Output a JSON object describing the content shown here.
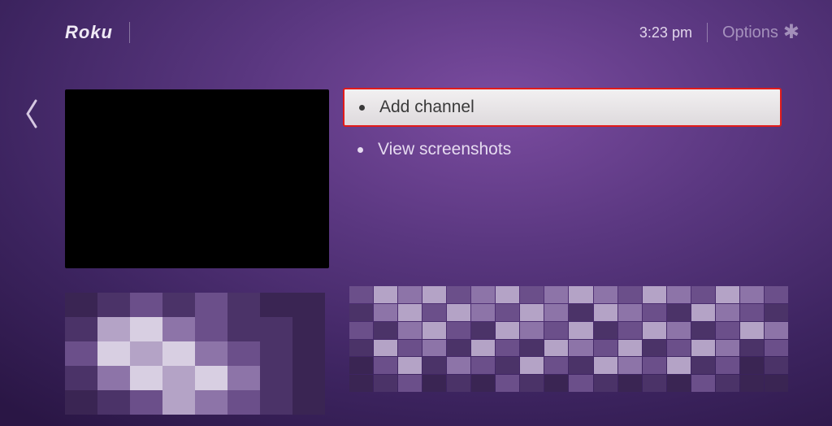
{
  "header": {
    "logo_text": "Roku",
    "time": "3:23 pm",
    "options_label": "Options"
  },
  "menu": {
    "items": [
      {
        "label": "Add channel",
        "selected": true
      },
      {
        "label": "View screenshots",
        "selected": false
      }
    ]
  }
}
